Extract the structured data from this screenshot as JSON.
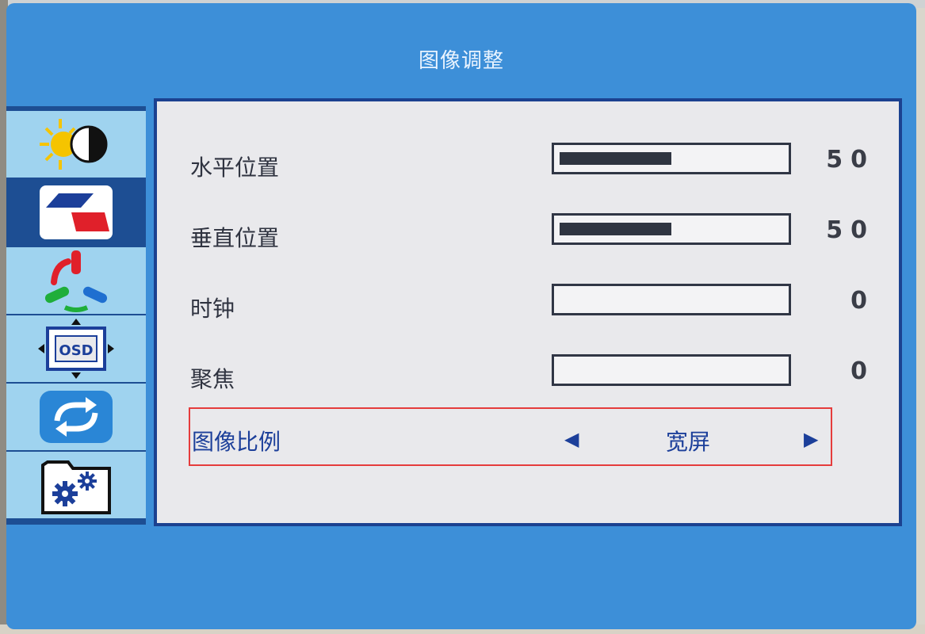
{
  "osd": {
    "title": "图像调整",
    "tabs": [
      {
        "name": "brightness-contrast",
        "icon": "brightness-contrast-icon",
        "active": false
      },
      {
        "name": "image-adjust",
        "icon": "image-adjust-icon",
        "active": true
      },
      {
        "name": "color",
        "icon": "color-rgb-icon",
        "active": false
      },
      {
        "name": "osd-settings",
        "icon": "osd-position-icon",
        "active": false
      },
      {
        "name": "reset",
        "icon": "reset-cycle-icon",
        "active": false
      },
      {
        "name": "system-settings",
        "icon": "gears-icon",
        "active": false
      }
    ],
    "settings": [
      {
        "label": "水平位置",
        "value": "50",
        "level": 0.5
      },
      {
        "label": "垂直位置",
        "value": "50",
        "level": 0.5
      },
      {
        "label": "时钟",
        "value": "0",
        "level": 0
      },
      {
        "label": "聚焦",
        "value": "0",
        "level": 0
      }
    ],
    "aspect": {
      "label": "图像比例",
      "value": "宽屏",
      "left_arrow": "◀",
      "right_arrow": "▶"
    },
    "colors": {
      "frame": "#3d8fd8",
      "sidebar": "#1d4e93",
      "tab": "#9fd3ef",
      "panel": "#e9e9ec",
      "highlight": "#e53c3c",
      "selected_text": "#1c3f9a"
    }
  }
}
